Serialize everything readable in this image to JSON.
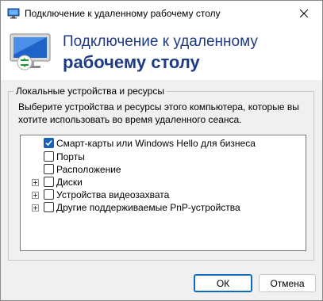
{
  "window": {
    "title": "Подключение к удаленному рабочему столу"
  },
  "banner": {
    "line1": "Подключение к удаленному",
    "line2": "рабочему столу"
  },
  "group": {
    "legend": "Локальные устройства и ресурсы",
    "description": "Выберите устройства и ресурсы этого компьютера, которые вы хотите использовать во время удаленного сеанса."
  },
  "devices": [
    {
      "label": "Смарт-карты или Windows Hello для бизнеса",
      "checked": true,
      "expandable": false
    },
    {
      "label": "Порты",
      "checked": false,
      "expandable": false
    },
    {
      "label": "Расположение",
      "checked": false,
      "expandable": false
    },
    {
      "label": "Диски",
      "checked": false,
      "expandable": true
    },
    {
      "label": "Устройства видеозахвата",
      "checked": false,
      "expandable": true
    },
    {
      "label": "Другие поддерживаемые PnP-устройства",
      "checked": false,
      "expandable": true
    }
  ],
  "buttons": {
    "ok": "ОК",
    "cancel": "Отмена"
  },
  "colors": {
    "accent": "#0f6cbd",
    "banner_text": "#1e3b84",
    "checkbox_checked": "#1660b8"
  }
}
